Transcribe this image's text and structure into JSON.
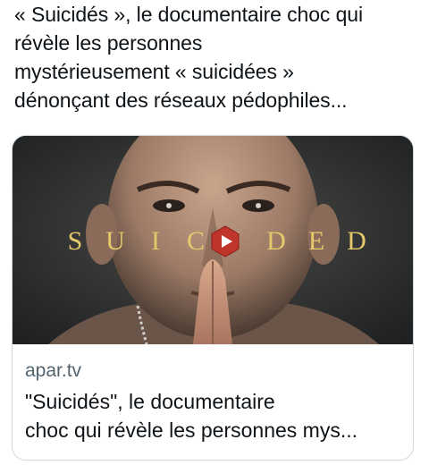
{
  "post": {
    "text_lines": [
      "« Suicidés », le documentaire choc qui",
      "révèle les personnes",
      "mystérieusement « suicidées »",
      "dénonçant des réseaux pédophiles..."
    ]
  },
  "link_card": {
    "overlay_title_letters": [
      "S",
      "U",
      "I",
      "C",
      "I",
      "D",
      "E",
      "D"
    ],
    "domain": "apar.tv",
    "title_lines": [
      "\"Suicidés\", le documentaire",
      "choc qui révèle les personnes mys..."
    ],
    "play_icon": "play-icon"
  },
  "colors": {
    "text_primary": "#0f1419",
    "text_secondary": "#536471",
    "card_border": "#cfd9de",
    "overlay_letter": "#e6c96a",
    "play_button": "#c0352b"
  }
}
